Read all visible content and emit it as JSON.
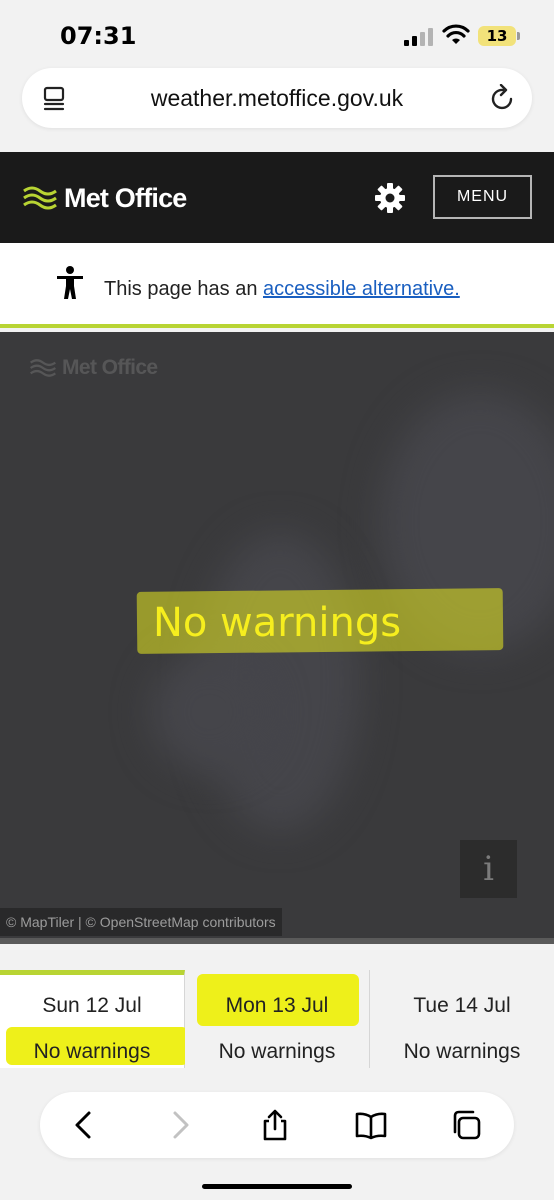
{
  "status_bar": {
    "time": "07:31",
    "battery": "13",
    "battery_color": "#f2e27a"
  },
  "browser": {
    "url": "weather.metoffice.gov.uk"
  },
  "header": {
    "brand": "Met Office",
    "menu_label": "MENU",
    "accent": "#b8d433"
  },
  "accessibility": {
    "text": "This page has an ",
    "link": "accessible alternative."
  },
  "map": {
    "watermark": "Met Office",
    "message": "No warnings",
    "info_label": "i",
    "attribution": "© MapTiler | © OpenStreetMap contributors"
  },
  "days": [
    {
      "date": "Sun 12 Jul",
      "status": "No warnings",
      "active": true
    },
    {
      "date": "Mon 13 Jul",
      "status": "No warnings",
      "active": false
    },
    {
      "date": "Tue 14 Jul",
      "status": "No warnings",
      "active": false
    }
  ],
  "highlight_color": "#eef01a",
  "toolbar": {
    "icons": [
      "back-icon",
      "forward-icon",
      "share-icon",
      "bookmarks-icon",
      "tabs-icon"
    ]
  }
}
